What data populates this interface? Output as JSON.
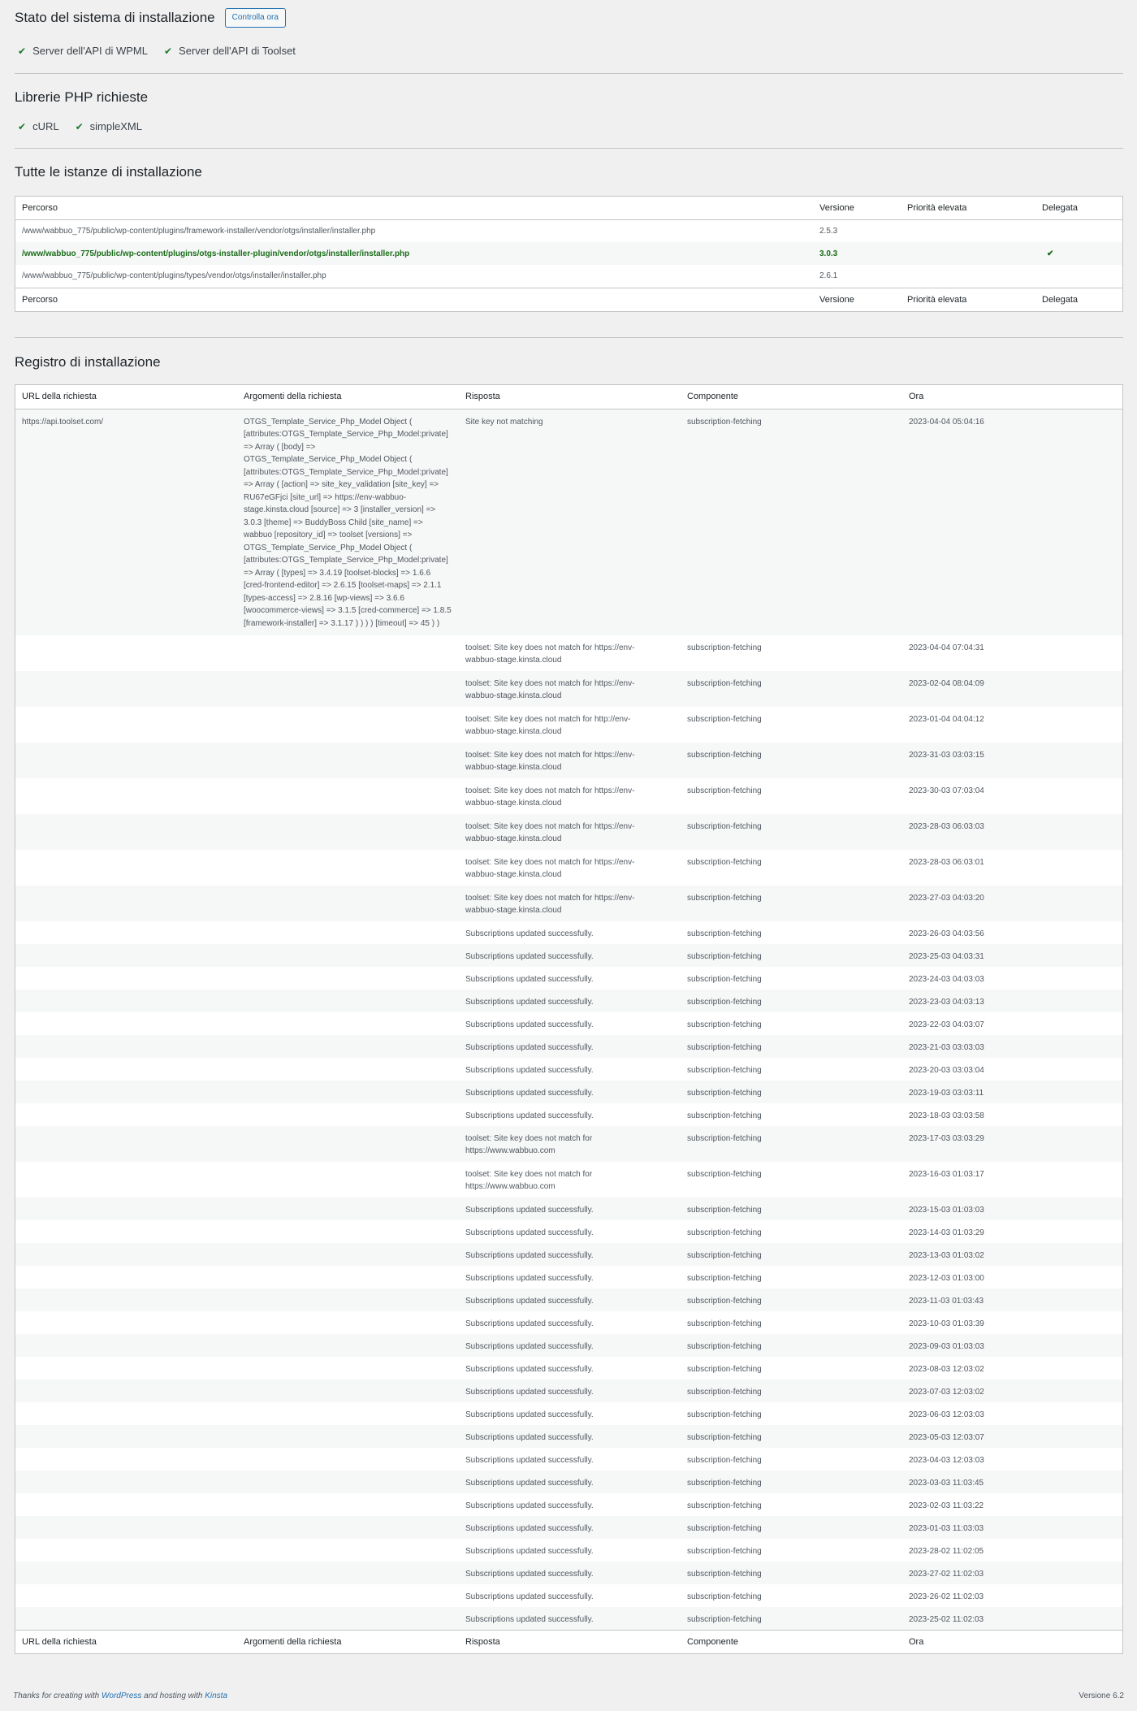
{
  "status": {
    "title": "Stato del sistema di installazione",
    "button": "Controlla ora",
    "items": [
      "Server dell'API di WPML",
      "Server dell'API di Toolset"
    ]
  },
  "php": {
    "title": "Librerie PHP richieste",
    "items": [
      "cURL",
      "simpleXML"
    ]
  },
  "instances": {
    "title": "Tutte le istanze di installazione",
    "headers": [
      "Percorso",
      "Versione",
      "Priorità elevata",
      "Delegata"
    ],
    "rows": [
      {
        "path": "/www/wabbuo_775/public/wp-content/plugins/framework-installer/vendor/otgs/installer/installer.php",
        "version": "2.5.3",
        "high": "",
        "delegated": ""
      },
      {
        "path": "/www/wabbuo_775/public/wp-content/plugins/otgs-installer-plugin/vendor/otgs/installer/installer.php",
        "version": "3.0.3",
        "high": "",
        "delegated": "✔"
      },
      {
        "path": "/www/wabbuo_775/public/wp-content/plugins/types/vendor/otgs/installer/installer.php",
        "version": "2.6.1",
        "high": "",
        "delegated": ""
      }
    ]
  },
  "log": {
    "title": "Registro di installazione",
    "headers": [
      "URL della richiesta",
      "Argomenti della richiesta",
      "Risposta",
      "Componente",
      "Ora"
    ],
    "first": {
      "url": "https://api.toolset.com/",
      "args": "OTGS_Template_Service_Php_Model Object ( [attributes:OTGS_Template_Service_Php_Model:private] => Array ( [body] => OTGS_Template_Service_Php_Model Object ( [attributes:OTGS_Template_Service_Php_Model:private] => Array ( [action] => site_key_validation [site_key] => RU67eGFjci [site_url] => https://env-wabbuo-stage.kinsta.cloud [source] => 3 [installer_version] => 3.0.3 [theme] => BuddyBoss Child [site_name] => wabbuo [repository_id] => toolset [versions] => OTGS_Template_Service_Php_Model Object ( [attributes:OTGS_Template_Service_Php_Model:private] => Array ( [types] => 3.4.19 [toolset-blocks] => 1.6.6 [cred-frontend-editor] => 2.6.15 [toolset-maps] => 2.1.1 [types-access] => 2.8.16 [wp-views] => 3.6.6 [woocommerce-views] => 3.1.5 [cred-commerce] => 1.8.5 [framework-installer] => 3.1.17 ) ) ) ) [timeout] => 45 ) )",
      "response": "Site key not matching",
      "component": "subscription-fetching",
      "time": "2023-04-04 05:04:16"
    },
    "rows": [
      [
        "toolset: Site key does not match for https://env-wabbuo-stage.kinsta.cloud",
        "subscription-fetching",
        "2023-04-04 07:04:31"
      ],
      [
        "toolset: Site key does not match for https://env-wabbuo-stage.kinsta.cloud",
        "subscription-fetching",
        "2023-02-04 08:04:09"
      ],
      [
        "toolset: Site key does not match for http://env-wabbuo-stage.kinsta.cloud",
        "subscription-fetching",
        "2023-01-04 04:04:12"
      ],
      [
        "toolset: Site key does not match for https://env-wabbuo-stage.kinsta.cloud",
        "subscription-fetching",
        "2023-31-03 03:03:15"
      ],
      [
        "toolset: Site key does not match for https://env-wabbuo-stage.kinsta.cloud",
        "subscription-fetching",
        "2023-30-03 07:03:04"
      ],
      [
        "toolset: Site key does not match for https://env-wabbuo-stage.kinsta.cloud",
        "subscription-fetching",
        "2023-28-03 06:03:03"
      ],
      [
        "toolset: Site key does not match for https://env-wabbuo-stage.kinsta.cloud",
        "subscription-fetching",
        "2023-28-03 06:03:01"
      ],
      [
        "toolset: Site key does not match for https://env-wabbuo-stage.kinsta.cloud",
        "subscription-fetching",
        "2023-27-03 04:03:20"
      ],
      [
        "Subscriptions updated successfully.",
        "subscription-fetching",
        "2023-26-03 04:03:56"
      ],
      [
        "Subscriptions updated successfully.",
        "subscription-fetching",
        "2023-25-03 04:03:31"
      ],
      [
        "Subscriptions updated successfully.",
        "subscription-fetching",
        "2023-24-03 04:03:03"
      ],
      [
        "Subscriptions updated successfully.",
        "subscription-fetching",
        "2023-23-03 04:03:13"
      ],
      [
        "Subscriptions updated successfully.",
        "subscription-fetching",
        "2023-22-03 04:03:07"
      ],
      [
        "Subscriptions updated successfully.",
        "subscription-fetching",
        "2023-21-03 03:03:03"
      ],
      [
        "Subscriptions updated successfully.",
        "subscription-fetching",
        "2023-20-03 03:03:04"
      ],
      [
        "Subscriptions updated successfully.",
        "subscription-fetching",
        "2023-19-03 03:03:11"
      ],
      [
        "Subscriptions updated successfully.",
        "subscription-fetching",
        "2023-18-03 03:03:58"
      ],
      [
        "toolset: Site key does not match for https://www.wabbuo.com",
        "subscription-fetching",
        "2023-17-03 03:03:29"
      ],
      [
        "toolset: Site key does not match for https://www.wabbuo.com",
        "subscription-fetching",
        "2023-16-03 01:03:17"
      ],
      [
        "Subscriptions updated successfully.",
        "subscription-fetching",
        "2023-15-03 01:03:03"
      ],
      [
        "Subscriptions updated successfully.",
        "subscription-fetching",
        "2023-14-03 01:03:29"
      ],
      [
        "Subscriptions updated successfully.",
        "subscription-fetching",
        "2023-13-03 01:03:02"
      ],
      [
        "Subscriptions updated successfully.",
        "subscription-fetching",
        "2023-12-03 01:03:00"
      ],
      [
        "Subscriptions updated successfully.",
        "subscription-fetching",
        "2023-11-03 01:03:43"
      ],
      [
        "Subscriptions updated successfully.",
        "subscription-fetching",
        "2023-10-03 01:03:39"
      ],
      [
        "Subscriptions updated successfully.",
        "subscription-fetching",
        "2023-09-03 01:03:03"
      ],
      [
        "Subscriptions updated successfully.",
        "subscription-fetching",
        "2023-08-03 12:03:02"
      ],
      [
        "Subscriptions updated successfully.",
        "subscription-fetching",
        "2023-07-03 12:03:02"
      ],
      [
        "Subscriptions updated successfully.",
        "subscription-fetching",
        "2023-06-03 12:03:03"
      ],
      [
        "Subscriptions updated successfully.",
        "subscription-fetching",
        "2023-05-03 12:03:07"
      ],
      [
        "Subscriptions updated successfully.",
        "subscription-fetching",
        "2023-04-03 12:03:03"
      ],
      [
        "Subscriptions updated successfully.",
        "subscription-fetching",
        "2023-03-03 11:03:45"
      ],
      [
        "Subscriptions updated successfully.",
        "subscription-fetching",
        "2023-02-03 11:03:22"
      ],
      [
        "Subscriptions updated successfully.",
        "subscription-fetching",
        "2023-01-03 11:03:03"
      ],
      [
        "Subscriptions updated successfully.",
        "subscription-fetching",
        "2023-28-02 11:02:05"
      ],
      [
        "Subscriptions updated successfully.",
        "subscription-fetching",
        "2023-27-02 11:02:03"
      ],
      [
        "Subscriptions updated successfully.",
        "subscription-fetching",
        "2023-26-02 11:02:03"
      ],
      [
        "Subscriptions updated successfully.",
        "subscription-fetching",
        "2023-25-02 11:02:03"
      ]
    ]
  },
  "footer": {
    "pre": "Thanks for creating with ",
    "wp": "WordPress",
    "mid": " and hosting with ",
    "host": "Kinsta",
    "version": "Versione 6.2"
  }
}
